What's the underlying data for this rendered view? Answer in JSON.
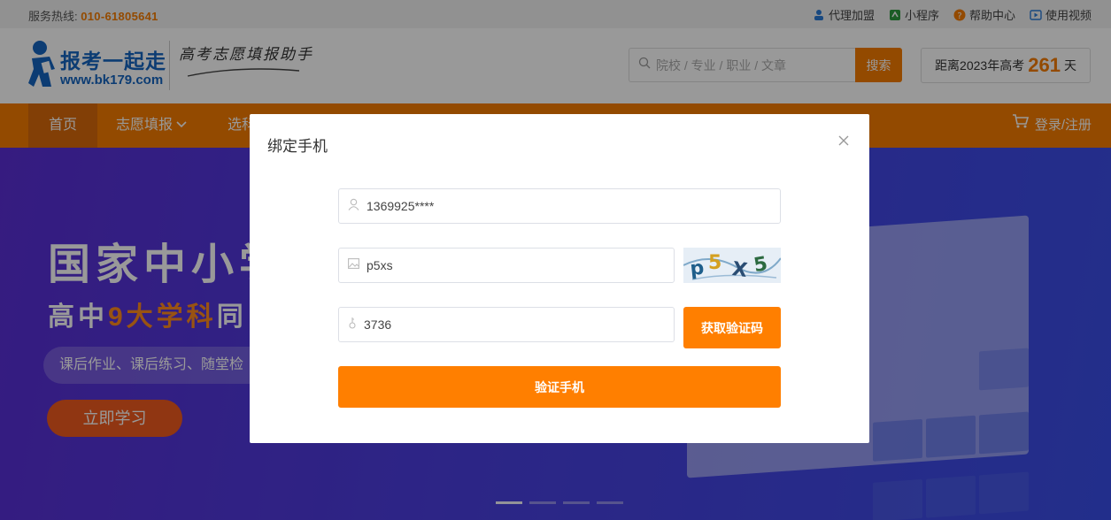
{
  "topbar": {
    "hotline_label": "服务热线:",
    "hotline_number": "010-61805641",
    "links": [
      {
        "label": "代理加盟",
        "icon": "agent-icon"
      },
      {
        "label": "小程序",
        "icon": "mini-program-icon"
      },
      {
        "label": "帮助中心",
        "icon": "help-icon"
      },
      {
        "label": "使用视频",
        "icon": "video-icon"
      }
    ]
  },
  "header": {
    "logo_title": "报考一起走",
    "logo_url": "www.bk179.com",
    "slogan": "高考志愿填报助手",
    "search": {
      "placeholder": "院校 / 专业 / 职业 / 文章",
      "button": "搜索"
    },
    "countdown": {
      "prefix": "距离2023年高考",
      "days": "261",
      "suffix": "天"
    }
  },
  "nav": {
    "home": "首页",
    "zhiyuan": "志愿填报",
    "xuanke": "选科",
    "login": "登录/注册"
  },
  "banner": {
    "title": "国家中小学",
    "subtitle_pre": "高中",
    "subtitle_hl": "9大学科",
    "subtitle_post": "同",
    "pill": "课后作业、课后练习、随堂检",
    "cta": "立即学习",
    "slides": 4,
    "active_slide": 1
  },
  "modal": {
    "title": "绑定手机",
    "phone": {
      "value": "1369925****",
      "icon": "user-icon"
    },
    "captcha": {
      "value": "p5xs",
      "icon": "image-icon",
      "image_text": "p5X5"
    },
    "sms": {
      "value": "3736",
      "icon": "key-icon",
      "button": "获取验证码"
    },
    "verify_button": "验证手机"
  },
  "colors": {
    "brand_orange": "#f57c00",
    "banner_purple": "#4a3fe0",
    "logo_blue": "#1565c0"
  }
}
